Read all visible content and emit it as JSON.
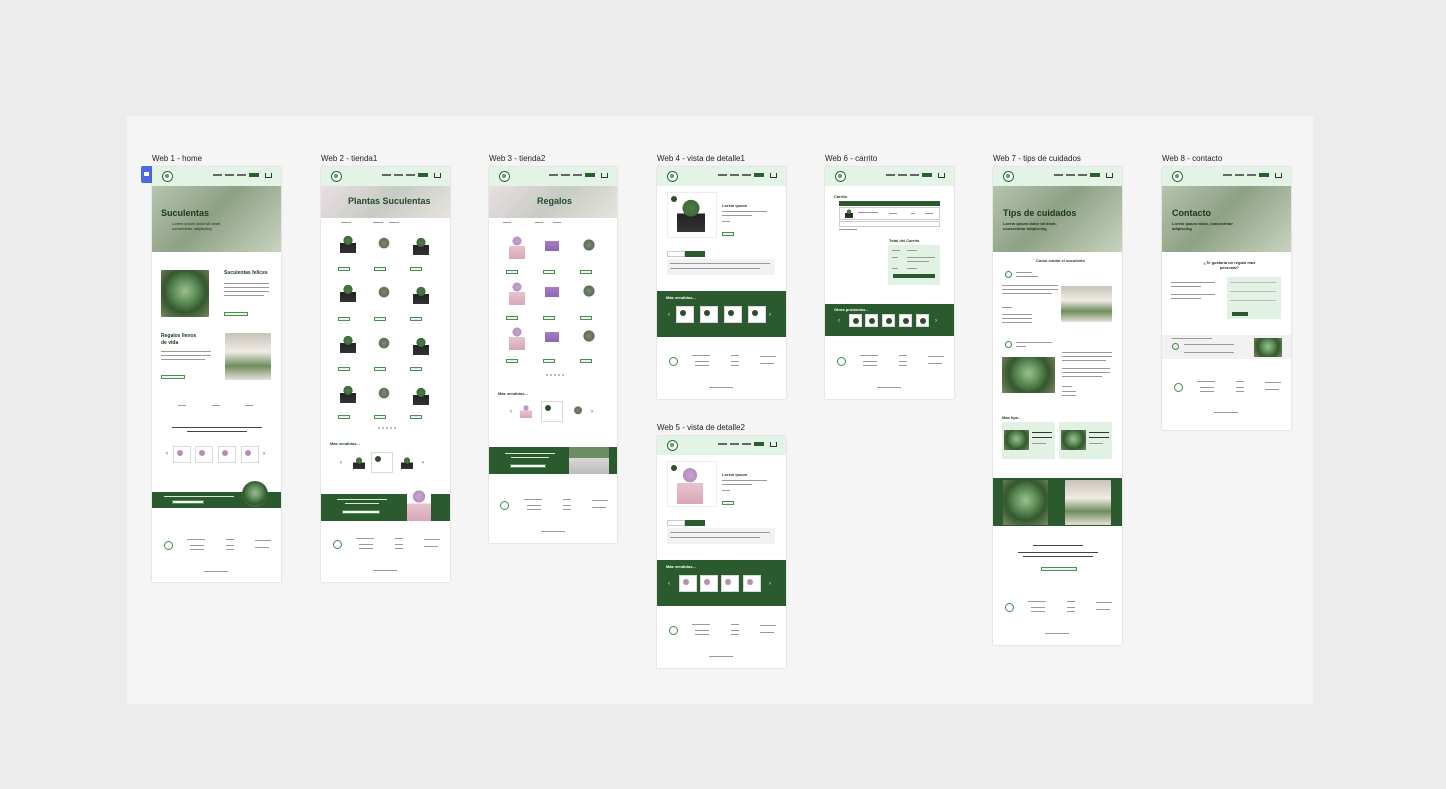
{
  "artboards": [
    {
      "id": "home",
      "label": "Web 1 - home",
      "hero_title": "Suculentas",
      "hero_sub": "Lorem ipsum dolor sit amet, consectetur adipiscing",
      "section1_title": "Suculentas felices",
      "section2_title": "Regalos llenos de vida"
    },
    {
      "id": "tienda1",
      "label": "Web 2 - tienda1",
      "hero_title": "Plantas Suculentas",
      "section_title": "Más vendidos..."
    },
    {
      "id": "tienda2",
      "label": "Web 3 - tienda2",
      "hero_title": "Regalos",
      "section_title": "Más vendidos..."
    },
    {
      "id": "detalle1",
      "label": "Web 4 - vista de detalle1",
      "product_title": "Lorem ipsum",
      "section_title": "Más vendidos..."
    },
    {
      "id": "detalle2",
      "label": "Web 5 - vista de detalle2",
      "product_title": "Lorem ipsum",
      "section_title": "Más vendidos..."
    },
    {
      "id": "carrito",
      "label": "Web 6 - carrito",
      "cart_title": "Carrito",
      "total_title": "Total del Carrito",
      "section_title": "Otros productos..."
    },
    {
      "id": "tips",
      "label": "Web 7 - tips de cuidados",
      "hero_title": "Tips de cuidados",
      "hero_sub": "Lorem ipsum dolor sit amet, consectetur adipiscing",
      "section1_title": "Como cuidar el suculento",
      "section2_title": "Mas tips..."
    },
    {
      "id": "contacto",
      "label": "Web 8 - contacto",
      "hero_title": "Contacto",
      "hero_sub": "Lorem ipsum dolor, consectetur adipiscing",
      "form_title": "¿Te gustaría un regalo más personal?"
    }
  ],
  "colors": {
    "brand": "#2c5a2f",
    "accent": "#e3f3e6",
    "selection": "#4b6be0"
  },
  "icons": {
    "home_marker": "home-icon",
    "cart": "cart-icon",
    "logo": "logo-icon"
  }
}
